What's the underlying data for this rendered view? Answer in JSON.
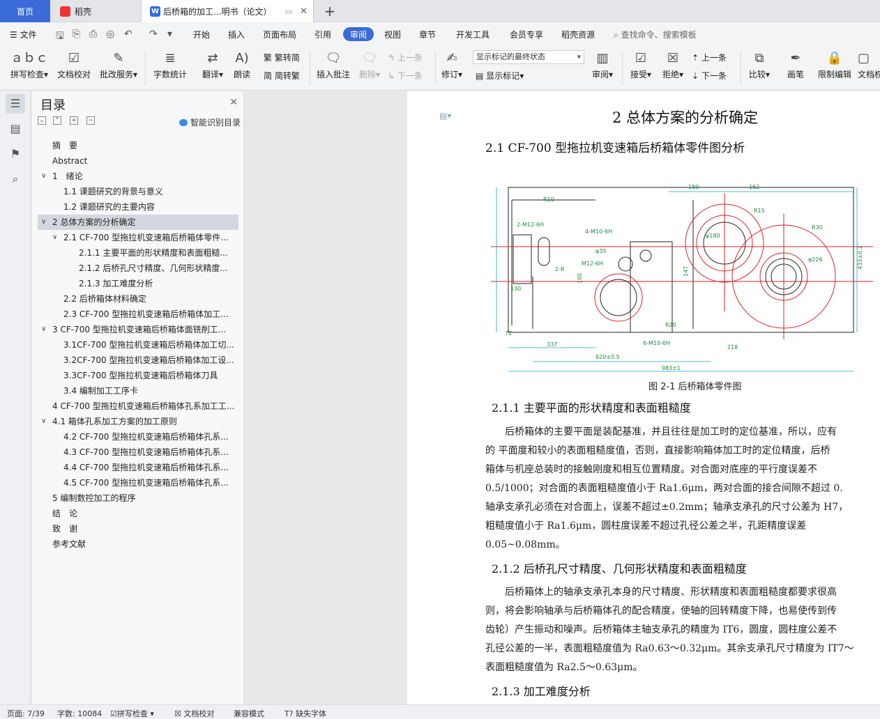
{
  "tabs": {
    "home": "首页",
    "daoke": "稻壳",
    "document": "后桥箱的加工...明书（论文）",
    "add": "+",
    "close": "✕"
  },
  "menu": {
    "file": "文件",
    "items": [
      "开始",
      "插入",
      "页面布局",
      "引用",
      "审阅",
      "视图",
      "章节",
      "开发工具",
      "会员专享",
      "稻壳资源"
    ],
    "active": "审阅",
    "search": "查找命令、搜索模板"
  },
  "ribbon": {
    "spellcheck": "拼写检查",
    "doccheck": "文档校对",
    "correction": "批改服务",
    "wordcount": "字数统计",
    "translate": "翻译",
    "read_aloud": "朗读",
    "trad_to_simp": "繁转简",
    "simp_to_trad": "简转繁",
    "insert_comment": "插入批注",
    "delete": "删除",
    "prev": "上一条",
    "next": "下一条",
    "revise": "修订",
    "markup_state": "显示标记的最终状态",
    "show_markup": "显示标记",
    "review": "审阅",
    "accept": "接受",
    "reject": "拒绝",
    "prev2": "上一条",
    "next2": "下一条",
    "compare": "比较",
    "pen": "画笔",
    "restrict": "限制编辑",
    "doc_rights": "文档权"
  },
  "toc": {
    "title": "目录",
    "smart": "智能识别目录",
    "items": [
      {
        "text": "摘　要",
        "level": 1,
        "arrow": ""
      },
      {
        "text": "Abstract",
        "level": 1,
        "arrow": ""
      },
      {
        "text": "1　绪论",
        "level": 1,
        "arrow": "∨"
      },
      {
        "text": "1.1 课题研究的背景与意义",
        "level": 2,
        "arrow": ""
      },
      {
        "text": "1.2 课题研究的主要内容",
        "level": 2,
        "arrow": ""
      },
      {
        "text": "2 总体方案的分析确定",
        "level": 1,
        "arrow": "∨",
        "selected": true
      },
      {
        "text": "2.1 CF-700 型拖拉机变速箱后桥箱体零件...",
        "level": 2,
        "arrow": "∨"
      },
      {
        "text": "2.1.1 主要平面的形状精度和表面粗糙...",
        "level": 3,
        "arrow": ""
      },
      {
        "text": "2.1.2 后桥孔尺寸精度、几何形状精度...",
        "level": 3,
        "arrow": ""
      },
      {
        "text": "2.1.3 加工难度分析",
        "level": 3,
        "arrow": ""
      },
      {
        "text": "2.2 后桥箱体材料确定",
        "level": 2,
        "arrow": ""
      },
      {
        "text": "2.3 CF-700 型拖拉机变速箱后桥箱体加工...",
        "level": 2,
        "arrow": ""
      },
      {
        "text": "3 CF-700 型拖拉机变速箱后桥箱体面铣削工...",
        "level": 1,
        "arrow": "∨"
      },
      {
        "text": "3.1CF-700 型拖拉机变速箱后桥箱体加工切...",
        "level": 2,
        "arrow": ""
      },
      {
        "text": "3.2CF-700 型拖拉机变速箱后桥箱体加工设...",
        "level": 2,
        "arrow": ""
      },
      {
        "text": "3.3CF-700 型拖拉机变速箱后桥箱体刀具",
        "level": 2,
        "arrow": ""
      },
      {
        "text": "3.4 编制加工工序卡",
        "level": 2,
        "arrow": ""
      },
      {
        "text": "4 CF-700 型拖拉机变速箱后桥箱体孔系加工工...",
        "level": 1,
        "arrow": ""
      },
      {
        "text": "4.1 箱体孔系加工方案的加工原则",
        "level": 1,
        "arrow": "∨"
      },
      {
        "text": "4.2 CF-700 型拖拉机变速箱后桥箱体孔系...",
        "level": 2,
        "arrow": ""
      },
      {
        "text": "4.3 CF-700 型拖拉机变速箱后桥箱体孔系...",
        "level": 2,
        "arrow": ""
      },
      {
        "text": "4.4 CF-700 型拖拉机变速箱后桥箱体孔系...",
        "level": 2,
        "arrow": ""
      },
      {
        "text": "4.5 CF-700 型拖拉机变速箱后桥箱体孔系...",
        "level": 2,
        "arrow": ""
      },
      {
        "text": "5 编制数控加工的程序",
        "level": 1,
        "arrow": ""
      },
      {
        "text": "结　论",
        "level": 1,
        "arrow": ""
      },
      {
        "text": "致　谢",
        "level": 1,
        "arrow": ""
      },
      {
        "text": "参考文献",
        "level": 1,
        "arrow": ""
      }
    ]
  },
  "document": {
    "chapter_title": "2  总体方案的分析确定",
    "section_title": "2.1 CF-700 型拖拉机变速箱后桥箱体零件图分析",
    "figure_caption": "图 2-1 后桥箱体零件图",
    "h3_1": "2.1.1 主要平面的形状精度和表面粗糙度",
    "para1": [
      "　　后桥箱体的主要平面是装配基准，并且往往是加工时的定位基准，所以，应有",
      "的 平面度和较小的表面粗糙度值，否则，直接影响箱体加工时的定位精度，后桥",
      "箱体与机座总装时的接触刚度和相互位置精度。对合面对底座的平行度误差不",
      "0.5/1000；对合面的表面粗糙度值小于 Ra1.6μm，两对合面的接合间隙不超过 0.",
      "轴承支承孔必须在对合面上，误差不超过±0.2mm；轴承支承孔的尺寸公差为 H7，",
      "粗糙度值小于 Ra1.6μm，圆柱度误差不超过孔径公差之半，孔距精度误差",
      "0.05~0.08mm。"
    ],
    "h3_2": "2.1.2 后桥孔尺寸精度、几何形状精度和表面粗糙度",
    "para2": [
      "　　后桥箱体上的轴承支承孔本身的尺寸精度、形状精度和表面粗糙度都要求很高",
      "则，将会影响轴承与后桥箱体孔的配合精度，使轴的回转精度下降，也易使传到传",
      "齿轮）产生振动和噪声。后桥箱体主轴支承孔的精度为 IT6，圆度，圆柱度公差不",
      "孔径公差的一半，表面粗糙度值为 Ra0.63～0.32μm。其余支承孔尺寸精度为 IT7～",
      "表面粗糙度值为 Ra2.5～0.63μm。"
    ],
    "h3_3": "2.1.3 加工难度分析",
    "drawing_labels": {
      "top_dims": [
        "150",
        "162"
      ],
      "right_dim": "433±0.2",
      "dim_130": "130",
      "dim_72": "72",
      "dim_337": "337",
      "dim_620": "620±0.5",
      "dim_983": "983±1",
      "dim_218": "218",
      "dim_100": "100",
      "dim_147": "147",
      "thread1": "2-M12-6H",
      "thread2": "M12-6H",
      "thread3": "4-M10-6H",
      "thread4": "6-M10-6H",
      "r10": "R10",
      "r15": "R15",
      "r20": "R20",
      "r30": "R30",
      "r2": "2-R",
      "phi180": "φ180",
      "phi226": "φ226",
      "phi35": "φ35"
    }
  },
  "status": {
    "page": "页面: 7/39",
    "words": "字数: 10084",
    "spell": "拼写检查",
    "doccheck": "文档校对",
    "compat": "兼容模式",
    "missing_font": "缺失字体"
  }
}
